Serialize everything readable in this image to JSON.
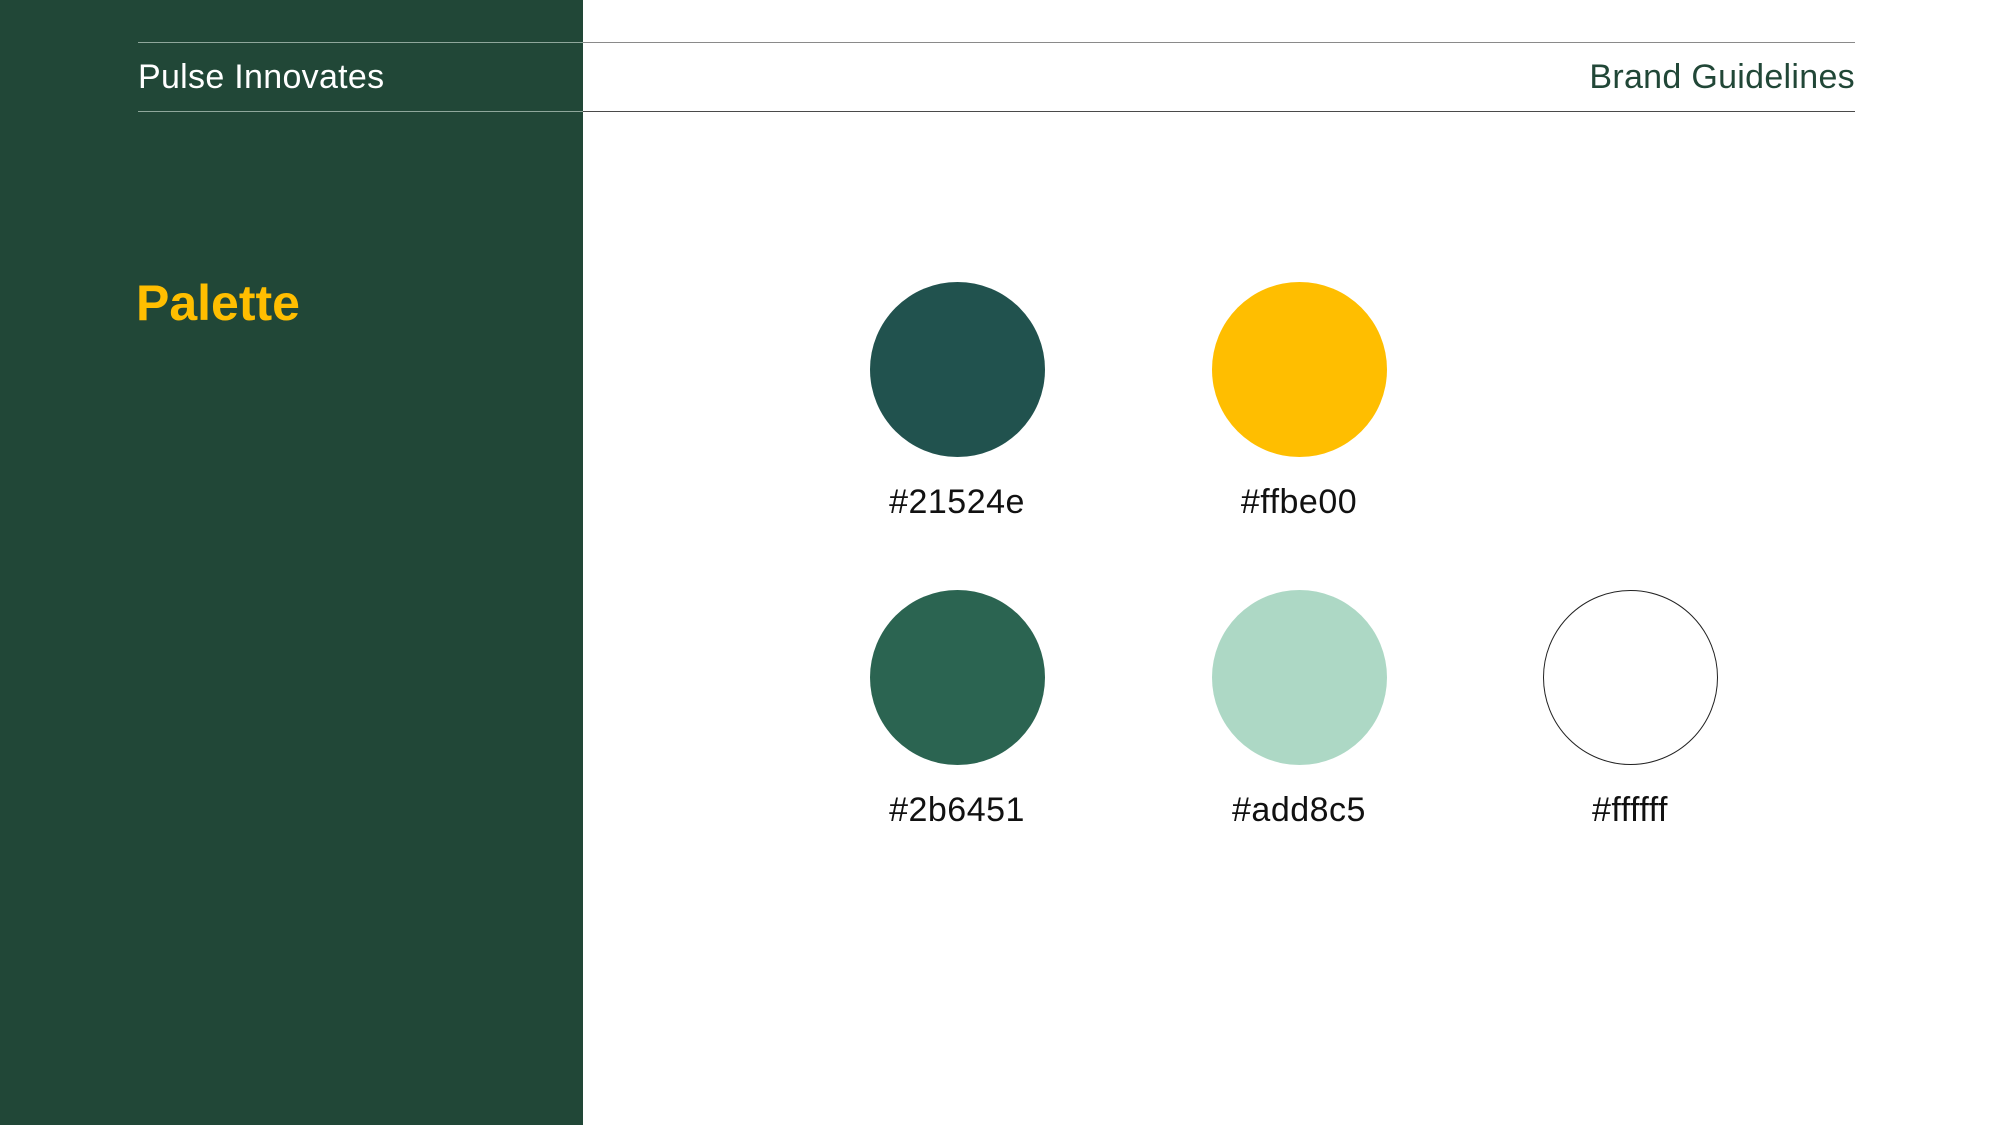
{
  "header": {
    "brand_name": "Pulse Innovates",
    "document_title": "Brand Guidelines"
  },
  "section": {
    "title": "Palette"
  },
  "colors": {
    "sidebar_bg": "#214737",
    "accent": "#ffbe00"
  },
  "palette": [
    {
      "hex": "#21524e",
      "label": "#21524e"
    },
    {
      "hex": "#ffbe00",
      "label": "#ffbe00"
    },
    {
      "hex": "#2b6451",
      "label": "#2b6451"
    },
    {
      "hex": "#add8c5",
      "label": "#add8c5"
    },
    {
      "hex": "#ffffff",
      "label": "#ffffff",
      "outlined": true
    }
  ]
}
